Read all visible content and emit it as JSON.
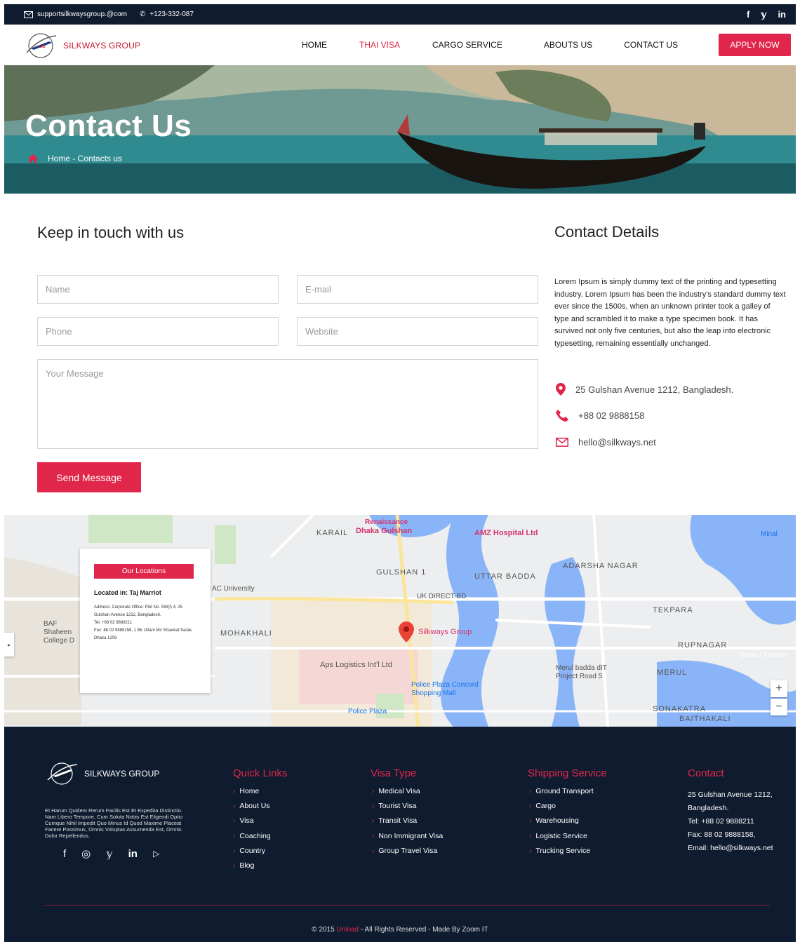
{
  "topbar": {
    "email": "supportsilkwaysgroup.@com",
    "phone": "+123-332-087",
    "social": [
      "facebook-icon",
      "twitter-icon",
      "linkedin-icon"
    ],
    "social_glyphs": [
      "f",
      "𝕪",
      "in"
    ]
  },
  "nav": {
    "brand": "SILKWAYS GROUP",
    "items": [
      "HOME",
      "THAI VISA",
      "CARGO SERVICE",
      "ABOUTS US",
      "CONTACT US"
    ],
    "apply": "APPLY NOW"
  },
  "hero": {
    "title": "Contact Us",
    "breadcrumb": "Home - Contacts us"
  },
  "form": {
    "heading": "Keep in touch with us",
    "name_placeholder": "Name",
    "email_placeholder": "E-mail",
    "phone_placeholder": "Phone",
    "website_placeholder": "Website",
    "message_placeholder": "Your Message",
    "submit": "Send Message"
  },
  "details": {
    "heading": "Contact Details",
    "text": "Lorem Ipsum is simply dummy text of the printing and typesetting industry. Lorem Ipsum has been the industry's standard dummy text ever since the 1500s, when an unknown printer took a galley of type and scrambled it to make a type specimen book. It has survived not only five centuries, but also the leap into electronic typesetting, remaining essentially unchanged.",
    "address": "25 Gulshan Avenue 1212, Bangladesh.",
    "phone": "+88 02 9888158",
    "email": "hello@silkways.net"
  },
  "map": {
    "card_button": "Our Locations",
    "located": "Located in: Taj Marriot",
    "card_address": "Address: Corporate Office: Plot No. SW(I) 4, 25 Gulshan Avenue 1212, Bangladesh.",
    "card_tel": "Tel: +88 02 9888211",
    "card_fax": "Fax: 88 02 9888158, 1 Bir Uttam Mir Shawkat Sarak, Dhaka 1208",
    "labels": [
      "KARAIL",
      "Renaissance",
      "Dhaka Gulshan",
      "AMZ Hospital Ltd",
      "ADARSHA NAGAR",
      "GULSHAN 1",
      "UTTAR BADDA",
      "UK DIRECT BD",
      "TEKPARA",
      "MOHAKHALI",
      "Silkways Group",
      "RUPNAGAR",
      "Aps Logistics Int'l Ltd",
      "MERUL",
      "Police Plaza Concord Shopping Mall",
      "SONAKATRA",
      "BAITHAKALI",
      "Merul badda dIT Project Road 5",
      "BAF Shaheen College D",
      "AC University",
      "Police Plaza",
      "Shimul Fisherie",
      "Minal"
    ],
    "zoom_in": "+",
    "zoom_out": "−"
  },
  "footer": {
    "brand": "SILKWAYS GROUP",
    "about": "Et Harum Quidem Rerum Facilis Est Et Expedita Distinctio. Nam Libero Tempore, Cum Soluta Nobis Est Eligendi Optio Cumque Nihil Impedit Quo Minus Id Quod Maxime Placeat Facere Possimus, Omnis Voluptas Assumenda Est, Omnis Dolor Repellendus.",
    "social": [
      "facebook-icon",
      "instagram-icon",
      "twitter-icon",
      "linkedin-icon",
      "youtube-icon"
    ],
    "social_glyphs": [
      "f",
      "◎",
      "𝕪",
      "in",
      "▷"
    ],
    "quick_title": "Quick Links",
    "quick": [
      "Home",
      "About Us",
      "Visa",
      "Coaching",
      "Country",
      "Blog"
    ],
    "visa_title": "Visa Type",
    "visa": [
      "Medical Visa",
      "Tourist Visa",
      "Transit Visa",
      "Non Immigrant Visa",
      "Group Travel Visa"
    ],
    "ship_title": "Shipping Service",
    "ship": [
      "Ground Transport",
      "Cargo",
      "Warehousing",
      "Logistic Service",
      "Trucking Service"
    ],
    "contact_title": "Contact",
    "contact_address": "25 Gulshan Avenue 1212, Bangladesh.",
    "contact_tel": "Tel: +88 02 9888211",
    "contact_fax": "Fax: 88 02 9888158,",
    "contact_email": "Email: hello@silkways.net",
    "copy_prefix": "© 2015 ",
    "copy_brand": "Unload",
    "copy_suffix": " - All Rights Reserved - Made By Zoom IT"
  },
  "colors": {
    "accent": "#e0264a",
    "dark": "#0f1c30"
  }
}
